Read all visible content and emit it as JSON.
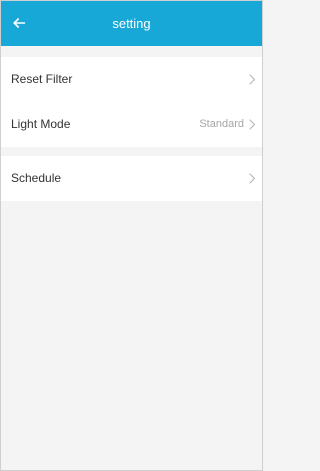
{
  "header": {
    "title": "setting",
    "back_icon": "arrow-left-icon",
    "background_color": "#17a8d8"
  },
  "settings": {
    "items": [
      {
        "label": "Reset Filter",
        "value": "",
        "icon": "chevron-right-icon"
      },
      {
        "label": "Light Mode",
        "value": "Standard",
        "icon": "chevron-right-icon"
      },
      {
        "label": "Schedule",
        "value": "",
        "icon": "chevron-right-icon"
      }
    ]
  },
  "colors": {
    "accent": "#17a8d8",
    "page_background": "#f4f4f4",
    "row_background": "#ffffff",
    "muted_text": "#a6a6a6"
  }
}
